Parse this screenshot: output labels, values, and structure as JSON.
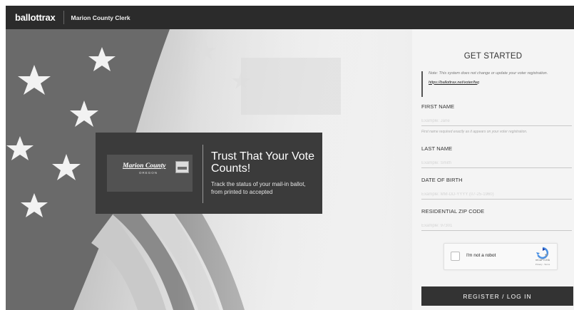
{
  "header": {
    "logo": "ballottrax",
    "title": "Marion County Clerk"
  },
  "promo": {
    "logo_text": "Marion County",
    "logo_sub": "OREGON",
    "heading": "Trust That Your Vote Counts!",
    "subtext": "Track the status of your mail-in ballot, from printed to accepted"
  },
  "form": {
    "title": "GET STARTED",
    "note": "Note: This system does not change or update your voter registration.",
    "faq_link": "https://ballottrax.net/voter/faq",
    "first_name": {
      "label": "FIRST NAME",
      "placeholder": "Example: Jane",
      "help": "First name required exactly as it appears on your voter registration."
    },
    "last_name": {
      "label": "LAST NAME",
      "placeholder": "Example: Smith"
    },
    "dob": {
      "label": "DATE OF BIRTH",
      "placeholder": "Example: MM-DD-YYYY (07-25-1960)"
    },
    "zip": {
      "label": "RESIDENTIAL ZIP CODE",
      "placeholder": "Example: 97301"
    },
    "recaptcha": {
      "label": "I'm not a robot",
      "brand": "reCAPTCHA",
      "terms": "Privacy - Terms"
    },
    "submit": "REGISTER / LOG IN"
  },
  "icons": {
    "recaptcha": "recaptcha-icon",
    "emblem": "county-emblem-icon"
  },
  "colors": {
    "header_bg": "#2b2b2b",
    "promo_bg": "#3b3b3b",
    "button_bg": "#333333",
    "panel_bg": "#f4f4f4"
  }
}
